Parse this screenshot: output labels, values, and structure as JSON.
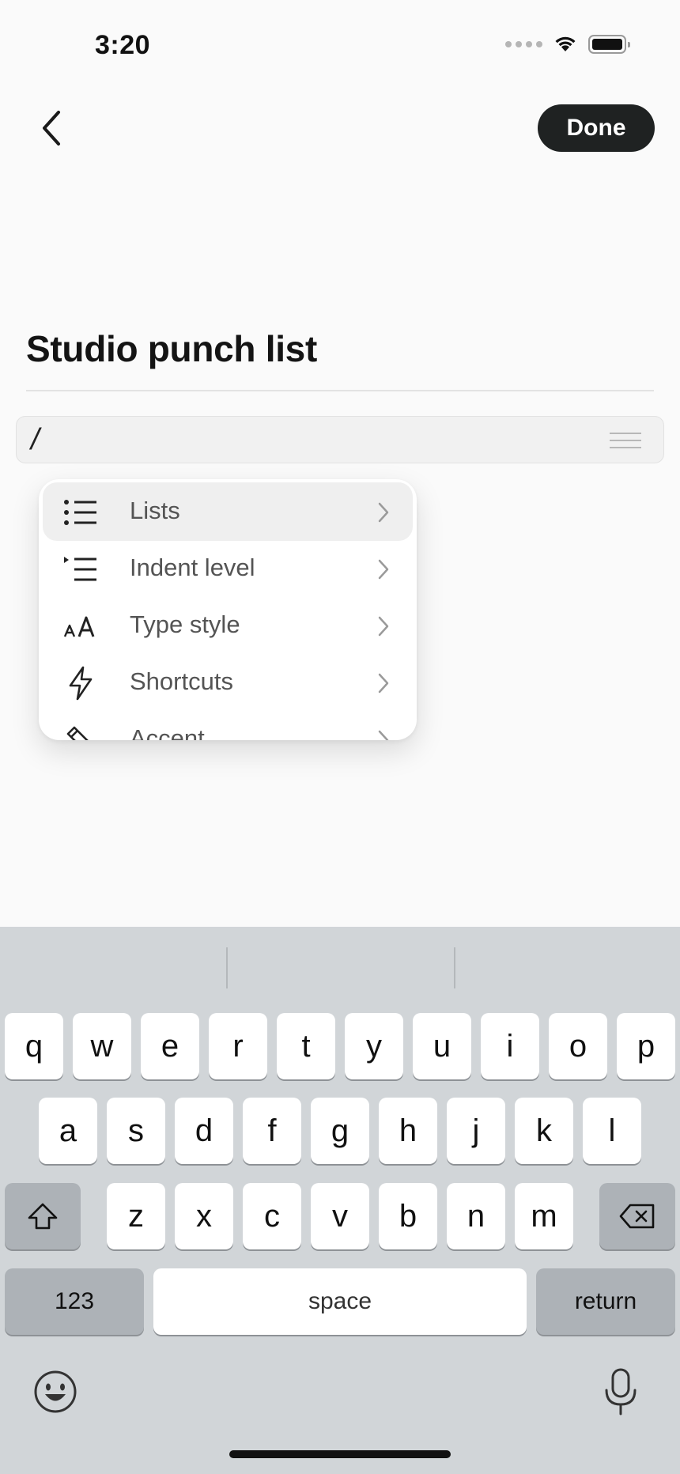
{
  "status_bar": {
    "time": "3:20",
    "icons": [
      "cellular-signal-icon",
      "wifi-icon",
      "battery-icon"
    ]
  },
  "nav": {
    "back_icon": "chevron-left-icon",
    "done_label": "Done"
  },
  "document": {
    "title": "Studio punch list",
    "slash_input": "/",
    "handle_icon": "drag-handle-icon"
  },
  "slash_menu": {
    "items": [
      {
        "label": "Lists",
        "icon": "bulleted-list-icon",
        "selected": true
      },
      {
        "label": "Indent level",
        "icon": "indent-icon",
        "selected": false
      },
      {
        "label": "Type style",
        "icon": "text-size-icon",
        "selected": false
      },
      {
        "label": "Shortcuts",
        "icon": "lightning-bolt-icon",
        "selected": false
      },
      {
        "label": "Accent",
        "icon": "highlighter-icon",
        "selected": false
      }
    ],
    "chevron_icon": "chevron-right-icon"
  },
  "keyboard": {
    "row1": [
      "q",
      "w",
      "e",
      "r",
      "t",
      "y",
      "u",
      "i",
      "o",
      "p"
    ],
    "row2": [
      "a",
      "s",
      "d",
      "f",
      "g",
      "h",
      "j",
      "k",
      "l"
    ],
    "row3": [
      "z",
      "x",
      "c",
      "v",
      "b",
      "n",
      "m"
    ],
    "numbers_label": "123",
    "space_label": "space",
    "return_label": "return",
    "shift_icon": "shift-icon",
    "delete_icon": "backspace-icon",
    "emoji_icon": "emoji-icon",
    "mic_icon": "microphone-icon"
  },
  "colors": {
    "background": "#fafafa",
    "done_button": "#1f2222",
    "keyboard_bg": "#d1d5d8",
    "key_bg": "#ffffff",
    "key_dark_bg": "#adb2b7",
    "menu_selected_bg": "#efefef",
    "menu_label": "#545454"
  }
}
